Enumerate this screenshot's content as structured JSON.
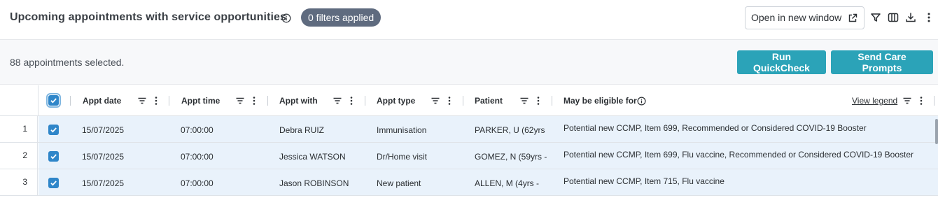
{
  "header": {
    "title": "Upcoming appointments with service opportunities",
    "filters_badge": "0 filters applied",
    "open_window_label": "Open in new window"
  },
  "selection": {
    "text": "88 appointments selected.",
    "run_quickcheck_label": "Run QuickCheck",
    "send_care_prompts_label": "Send Care Prompts"
  },
  "table": {
    "columns": [
      "Appt date",
      "Appt time",
      "Appt with",
      "Appt type",
      "Patient",
      "May be eligible for"
    ],
    "view_legend_label": "View legend",
    "rows": [
      {
        "index": "1",
        "date": "15/07/2025",
        "time": "07:00:00",
        "with": "Debra RUIZ",
        "type": "Immunisation",
        "patient": "PARKER, U (62yrs",
        "eligible": "Potential new CCMP, Item 699, Recommended or Considered COVID-19 Booster"
      },
      {
        "index": "2",
        "date": "15/07/2025",
        "time": "07:00:00",
        "with": "Jessica WATSON",
        "type": "Dr/Home visit",
        "patient": "GOMEZ, N (59yrs -",
        "eligible": "Potential new CCMP, Item 699, Flu vaccine, Recommended or Considered COVID-19 Booster"
      },
      {
        "index": "3",
        "date": "15/07/2025",
        "time": "07:00:00",
        "with": "Jason ROBINSON",
        "type": "New patient",
        "patient": "ALLEN, M (4yrs -",
        "eligible": "Potential new CCMP, Item 715, Flu vaccine"
      }
    ]
  },
  "colors": {
    "accent": "#2ba3b8",
    "badge": "#5f6b7f",
    "checkbox": "#2f86c9",
    "row_selected": "#e9f2fb"
  }
}
